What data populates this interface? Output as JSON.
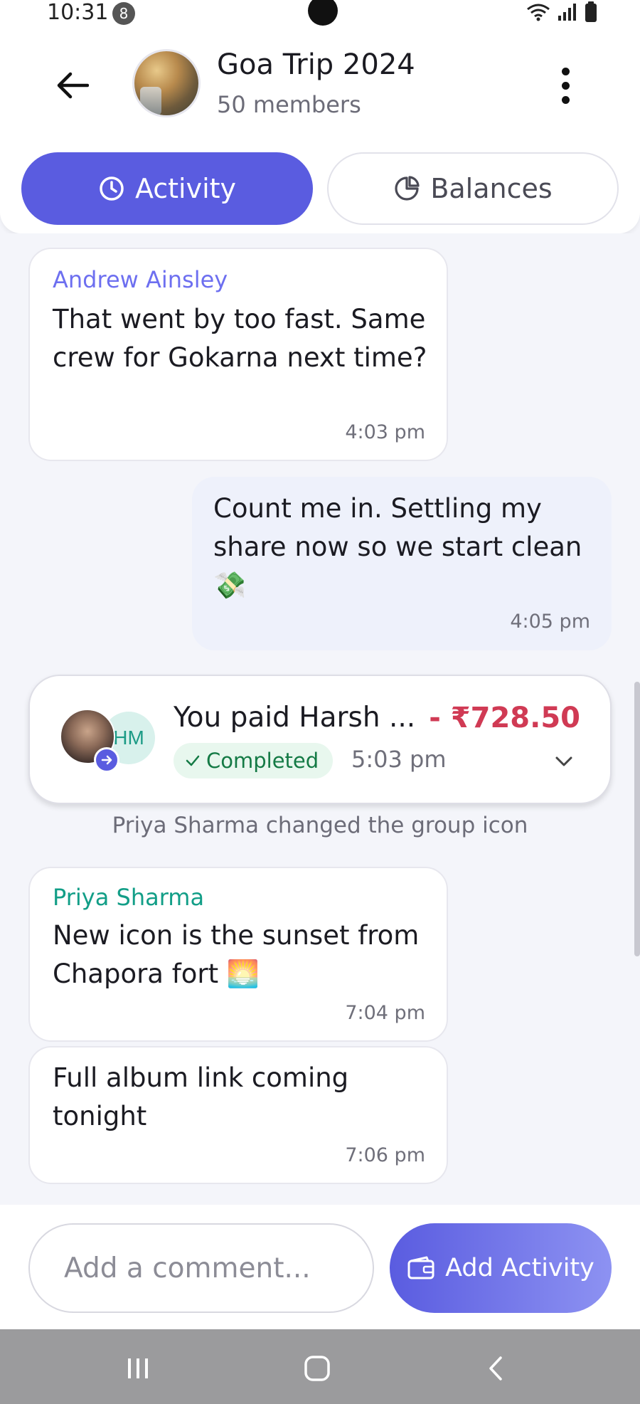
{
  "status_bar": {
    "time": "10:31",
    "notification_count": "8"
  },
  "header": {
    "title": "Goa Trip 2024",
    "subtitle": "50 members"
  },
  "tabs": [
    {
      "label": "Activity",
      "active": true,
      "icon": "clock-icon"
    },
    {
      "label": "Balances",
      "active": false,
      "icon": "pie-chart-icon"
    }
  ],
  "messages": [
    {
      "sender": "Andrew Ainsley",
      "sender_color": "#6d6ff0",
      "text": "That went by too fast. Same crew for Gokarna next time?",
      "time": "4:03 pm",
      "direction": "incoming"
    },
    {
      "sender": "",
      "text": "Count me in. Settling my share now so we start clean 💸",
      "time": "4:05 pm",
      "direction": "outgoing"
    }
  ],
  "payment": {
    "title": "You paid Harsh ...",
    "amount": "- ₹728.50",
    "status": "Completed",
    "time": "5:03 pm",
    "payee_initials": "HM"
  },
  "system_message": "Priya Sharma changed the group icon",
  "later_messages": [
    {
      "sender": "Priya Sharma",
      "sender_color": "#129e87",
      "text": "New icon is the sunset from Chapora fort 🌅",
      "time": "7:04 pm",
      "direction": "incoming"
    },
    {
      "sender": "",
      "text": "Full album link coming tonight",
      "time": "7:06 pm",
      "direction": "incoming"
    }
  ],
  "composer": {
    "placeholder": "Add a comment...",
    "add_activity_label": "Add Activity"
  },
  "colors": {
    "accent": "#5a5ce0",
    "amount_negative": "#d03a54",
    "status_completed": "#147a45"
  }
}
